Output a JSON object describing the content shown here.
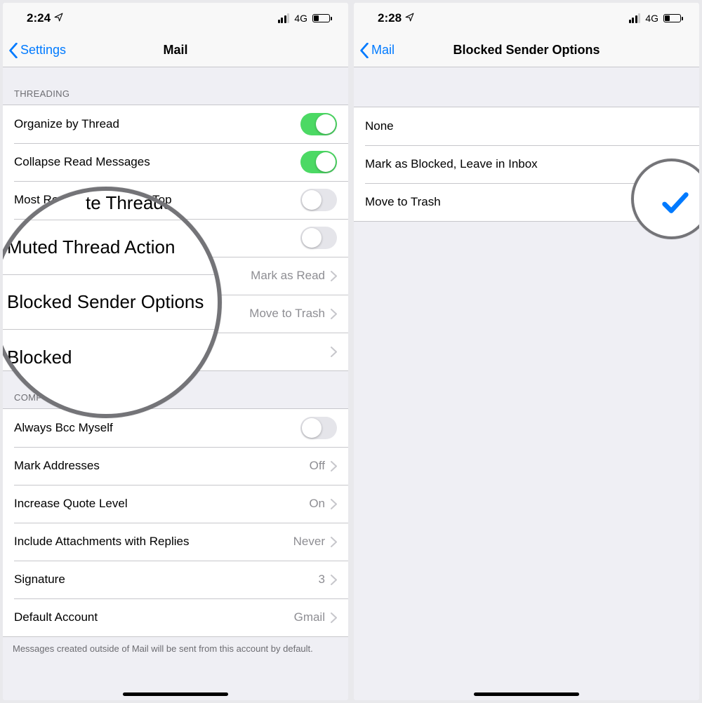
{
  "left": {
    "status": {
      "time": "2:24",
      "network": "4G"
    },
    "nav": {
      "back": "Settings",
      "title": "Mail"
    },
    "threading_header": "THREADING",
    "rows": {
      "organize": "Organize by Thread",
      "collapse": "Collapse Read Messages",
      "most_recent": "Most Recent Message on Top",
      "complete_threads": "Complete Threads",
      "muted_action": "Muted Thread Action",
      "muted_value": "Mark as Read",
      "blocked_options": "Blocked Sender Options",
      "blocked_value": "Move to Trash",
      "blocked": "Blocked"
    },
    "composing_header": "COMPOSING",
    "composing": {
      "bcc": "Always Bcc Myself",
      "mark_addresses": "Mark Addresses",
      "mark_addresses_value": "Off",
      "increase_quote": "Increase Quote Level",
      "increase_quote_value": "On",
      "include_attach": "Include Attachments with Replies",
      "include_attach_value": "Never",
      "signature": "Signature",
      "signature_value": "3",
      "default_account": "Default Account",
      "default_account_value": "Gmail"
    },
    "footer": "Messages created outside of Mail will be sent from this account by default.",
    "magnifier": {
      "row0_partial": "te Threads",
      "row1": "Muted Thread Action",
      "row2": "Blocked Sender Options",
      "row3": "Blocked"
    }
  },
  "right": {
    "status": {
      "time": "2:28",
      "network": "4G"
    },
    "nav": {
      "back": "Mail",
      "title": "Blocked Sender Options"
    },
    "options": {
      "none": "None",
      "mark_leave": "Mark as Blocked, Leave in Inbox",
      "move_trash": "Move to Trash"
    }
  }
}
